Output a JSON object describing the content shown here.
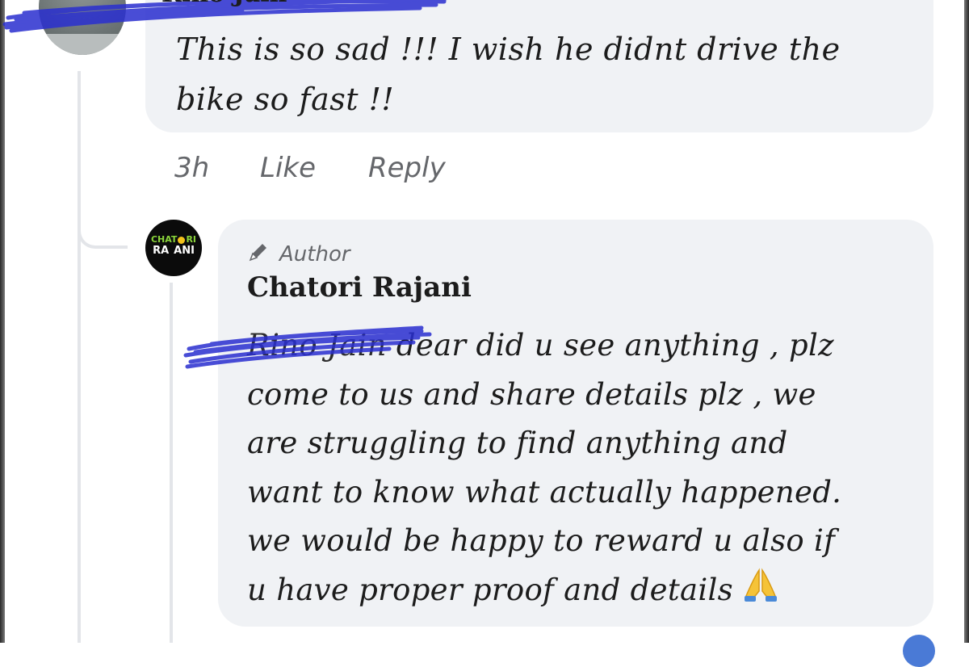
{
  "comment": {
    "author_name": "Rino Jain",
    "text_line1": "This is so sad !!! I wish he didnt drive the",
    "text_line2": "bike so fast !!",
    "time": "3h",
    "like_label": "Like",
    "reply_label": "Reply"
  },
  "reply": {
    "badge_label": "Author",
    "author_name": "Chatori Rajani",
    "logo_line1_left": "CHAT",
    "logo_line1_right": "RI",
    "logo_line2_left": "RA",
    "logo_line2_right": "ANI",
    "mention": "Rino Jain",
    "text_line1": " dear did u see anything , plz",
    "text_line2": "come to us and share details plz , we",
    "text_line3": "are struggling to find anything  and",
    "text_line4": "want to know what actually happened.",
    "text_line5": "we would be happy to reward u also if",
    "text_line6": "u have proper proof and details",
    "emoji": "folded-hands"
  },
  "colors": {
    "bubble": "#f0f2f5",
    "meta_text": "#65676b",
    "redaction_scribble": "#2a2fd0"
  }
}
